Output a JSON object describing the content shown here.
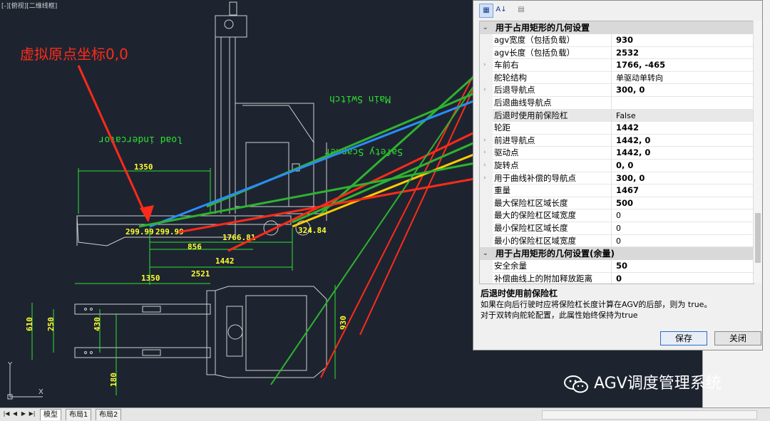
{
  "viewport_label": "[-][俯视][二维线框]",
  "origin_annotation": "虚拟原点坐标0,0",
  "drawing_labels": {
    "main_switch": "Main Switch",
    "load_indicator": "load indercator",
    "safety_scanner": "Safety Scanner",
    "dim_1350_top": "1350",
    "dim_299_left": "299.99",
    "dim_299_right": "299.99",
    "dim_1766": "1766.81",
    "dim_324": "324.84",
    "dim_856": "856",
    "dim_1442": "1442",
    "dim_2521": "2521",
    "dim_1350_bottom": "1350",
    "dim_610": "610",
    "dim_250": "250",
    "dim_430": "430",
    "dim_180": "180",
    "dim_930": "930",
    "ucs_x": "X",
    "ucs_y": "Y"
  },
  "status_bar": {
    "tabs": [
      "模型",
      "布局1",
      "布局2"
    ],
    "nav_buttons": [
      "|◀",
      "◀",
      "▶",
      "▶|"
    ]
  },
  "panel": {
    "toolbar_icons": [
      "categorized-icon",
      "alphabetical-icon",
      "property-pages-icon"
    ],
    "toolbar_glyphs": [
      "▦",
      "A↓",
      "▤"
    ],
    "categories": [
      {
        "title": "用于占用矩形的几何设置",
        "rows": [
          {
            "name": "agv宽度（包括负载）",
            "value": "930",
            "bold": true,
            "expandable": false
          },
          {
            "name": "agv长度（包括负载）",
            "value": "2532",
            "bold": true,
            "expandable": false
          },
          {
            "name": "车前右",
            "value": "1766, -465",
            "bold": true,
            "expandable": true
          },
          {
            "name": "舵轮结构",
            "value": "单驱动单转向",
            "bold": false,
            "expandable": false
          },
          {
            "name": "后退导航点",
            "value": "300, 0",
            "bold": true,
            "expandable": true
          },
          {
            "name": "后退曲线导航点",
            "value": "",
            "bold": false,
            "expandable": false
          },
          {
            "name": "后退时使用前保险杠",
            "value": "False",
            "bold": false,
            "expandable": false,
            "selected": true
          },
          {
            "name": "轮距",
            "value": "1442",
            "bold": true,
            "expandable": false
          },
          {
            "name": "前进导航点",
            "value": "1442, 0",
            "bold": true,
            "expandable": true
          },
          {
            "name": "驱动点",
            "value": "1442, 0",
            "bold": true,
            "expandable": true
          },
          {
            "name": "旋转点",
            "value": "0, 0",
            "bold": true,
            "expandable": true
          },
          {
            "name": "用于曲线补偿的导航点",
            "value": "300, 0",
            "bold": true,
            "expandable": true
          },
          {
            "name": "重量",
            "value": "1467",
            "bold": true,
            "expandable": false
          },
          {
            "name": "最大保险杠区域长度",
            "value": "500",
            "bold": true,
            "expandable": false
          },
          {
            "name": "最大的保险杠区域宽度",
            "value": "0",
            "bold": false,
            "expandable": false
          },
          {
            "name": "最小保险杠区域长度",
            "value": "0",
            "bold": false,
            "expandable": false
          },
          {
            "name": "最小的保险杠区域宽度",
            "value": "0",
            "bold": false,
            "expandable": false
          }
        ]
      },
      {
        "title": "用于占用矩形的几何设置(余量)",
        "rows": [
          {
            "name": "安全余量",
            "value": "50",
            "bold": true,
            "expandable": false
          },
          {
            "name": "补偿曲线上的附加释放距离",
            "value": "0",
            "bold": true,
            "expandable": false
          }
        ]
      }
    ],
    "description_title": "后退时使用前保险杠",
    "description_line1": "如果在向后行驶时应将保险杠长度计算在AGV的后部，则为 true。",
    "description_line2": "对于双转向舵轮配置，此属性始终保持为true",
    "save_label": "保存",
    "close_label": "关闭"
  },
  "watermark": "AGV调度管理系统",
  "colors": {
    "arrow_red": "#ff2a1a",
    "arrow_green": "#2fb32f",
    "arrow_blue": "#2a8cff",
    "arrow_yellow": "#ffcc00",
    "dimension_yellow": "#ffff30",
    "dimension_green": "#30e030",
    "cad_background": "#1d2430"
  }
}
